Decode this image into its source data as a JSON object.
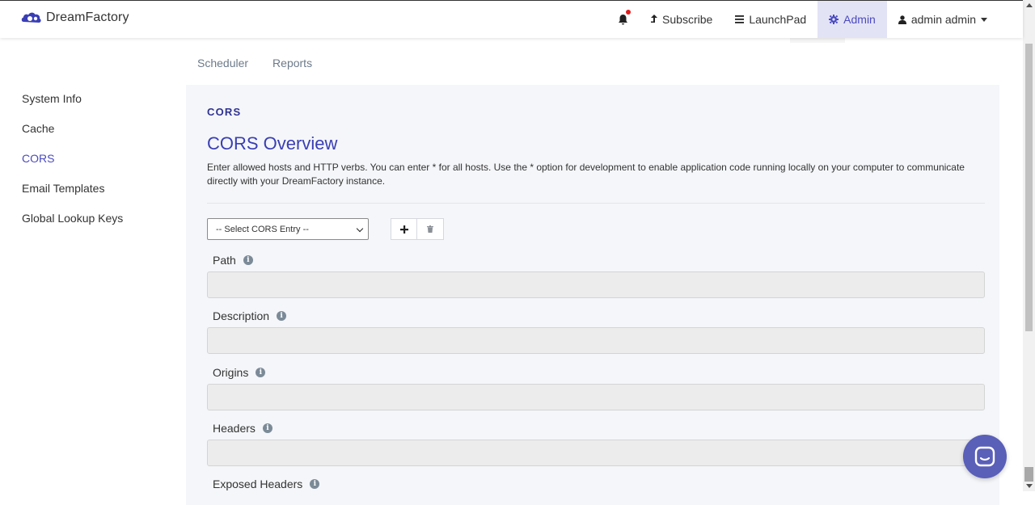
{
  "brand": {
    "name": "DreamFactory"
  },
  "nav": {
    "subscribe": "Subscribe",
    "launchpad": "LaunchPad",
    "admin": "Admin",
    "user": "admin admin"
  },
  "subnav": {
    "tabs": [
      "Scheduler",
      "Reports"
    ]
  },
  "sidebar": {
    "items": [
      {
        "label": "System Info",
        "active": false
      },
      {
        "label": "Cache",
        "active": false
      },
      {
        "label": "CORS",
        "active": true
      },
      {
        "label": "Email Templates",
        "active": false
      },
      {
        "label": "Global Lookup Keys",
        "active": false
      }
    ]
  },
  "main": {
    "section_label": "CORS",
    "title": "CORS Overview",
    "description": "Enter allowed hosts and HTTP verbs. You can enter * for all hosts. Use the * option for development to enable application code running locally on your computer to communicate directly with your DreamFactory instance.",
    "select_placeholder": "-- Select CORS Entry --",
    "fields": {
      "path": "Path",
      "description": "Description",
      "origins": "Origins",
      "headers": "Headers",
      "exposed_headers": "Exposed Headers"
    }
  },
  "colors": {
    "accent": "#3a3eb4",
    "admin_bg": "#e3e3f6",
    "notification": "#e21b1b",
    "chat": "#5a5fb8"
  }
}
